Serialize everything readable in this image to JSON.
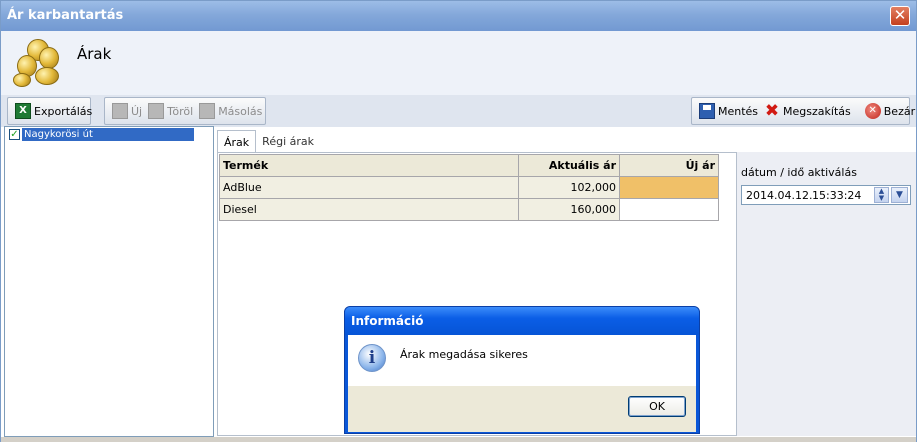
{
  "window": {
    "title": "Ár karbantartás",
    "close_glyph": "✕"
  },
  "header": {
    "title": "Árak",
    "icon": "coins-icon"
  },
  "toolbar": {
    "export_label": "Exportálás",
    "new_label": "Új",
    "delete_label": "Töröl",
    "copy_label": "Másolás",
    "save_label": "Mentés",
    "cancel_label": "Megszakítás",
    "close_label": "Bezár"
  },
  "tree": {
    "items": [
      {
        "label": "Nagykorösi út",
        "checked": true
      }
    ]
  },
  "tabs": [
    {
      "label": "Árak",
      "active": true
    },
    {
      "label": "Régi árak",
      "active": false
    }
  ],
  "grid": {
    "columns": [
      "Termék",
      "Aktuális ár",
      "Új ár"
    ],
    "rows": [
      {
        "product": "AdBlue",
        "current": "102,000",
        "new": ""
      },
      {
        "product": "Diesel",
        "current": "160,000",
        "new": ""
      }
    ]
  },
  "activation": {
    "label": "dátum / idő aktiválás",
    "date": "2014.04.12.",
    "time": "15:33:24"
  },
  "dialog": {
    "title": "Információ",
    "message": "Árak megadása sikeres",
    "ok_label": "OK"
  },
  "colors": {
    "title_bar": "#84a8da",
    "selection": "#316ac5",
    "highlight_cell": "#f0c068",
    "dialog_title": "#0654d6"
  }
}
